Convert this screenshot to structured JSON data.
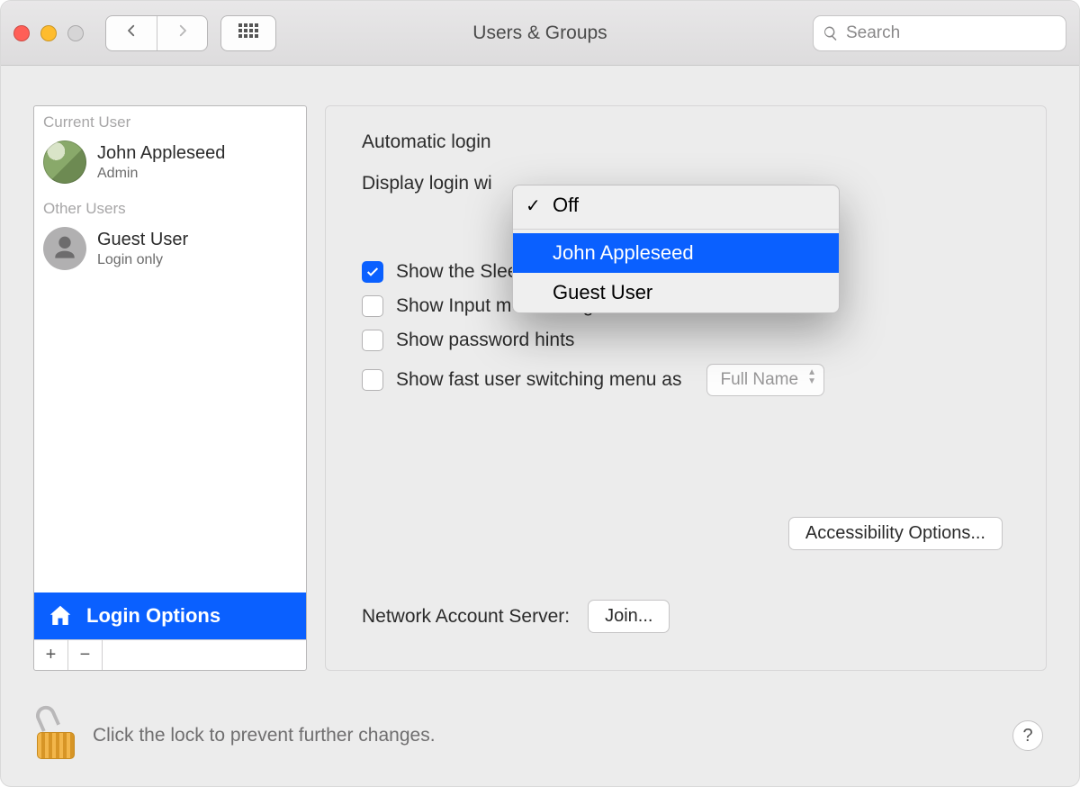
{
  "window": {
    "title": "Users & Groups"
  },
  "search": {
    "placeholder": "Search"
  },
  "sidebar": {
    "currentUserHeader": "Current User",
    "otherUsersHeader": "Other Users",
    "currentUser": {
      "name": "John Appleseed",
      "role": "Admin"
    },
    "otherUsers": [
      {
        "name": "Guest User",
        "role": "Login only"
      }
    ],
    "loginOptionsLabel": "Login Options"
  },
  "main": {
    "automaticLoginLabel": "Automatic login",
    "displayLoginLabel": "Display login wi",
    "checkboxes": {
      "showSleep": {
        "label": "Show the Sleep, Restart, and Shut Down buttons",
        "checked": true
      },
      "showInput": {
        "label": "Show Input menu in login window",
        "checked": false
      },
      "showHints": {
        "label": "Show password hints",
        "checked": false
      },
      "fastUser": {
        "label": "Show fast user switching menu as",
        "checked": false
      }
    },
    "fastUserSelect": "Full Name",
    "accessibilityButton": "Accessibility Options...",
    "networkLabel": "Network Account Server:",
    "joinButton": "Join..."
  },
  "dropdown": {
    "items": [
      "Off",
      "John Appleseed",
      "Guest User"
    ],
    "checkedIndex": 0,
    "highlightedIndex": 1
  },
  "footer": {
    "lockText": "Click the lock to prevent further changes."
  }
}
